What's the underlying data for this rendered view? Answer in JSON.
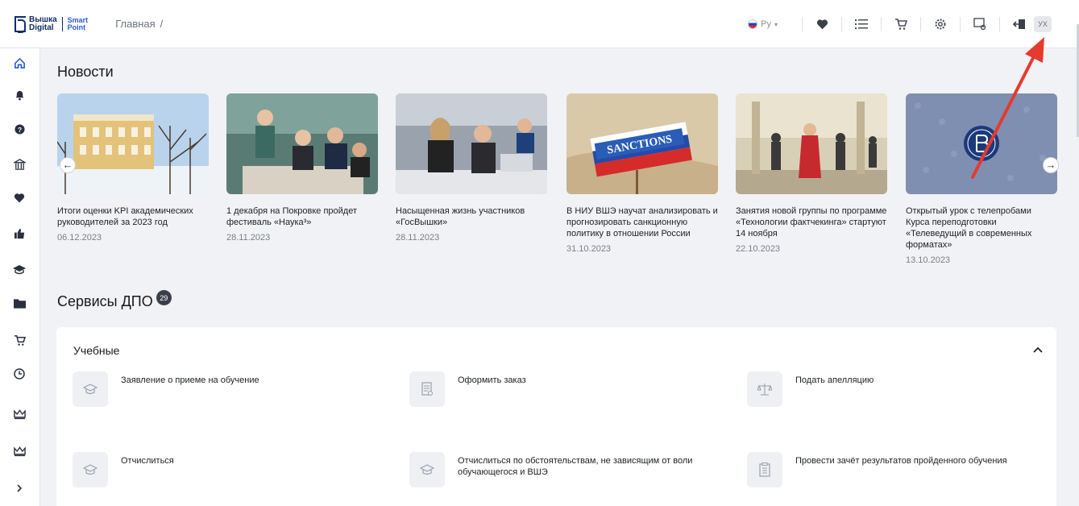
{
  "logo": {
    "line1": "Вышка",
    "line2": "Digital",
    "smart1": "Smart",
    "smart2": "Point"
  },
  "breadcrumb": {
    "home": "Главная",
    "separator": "/"
  },
  "header": {
    "lang": "Ру",
    "user_initials": "УХ"
  },
  "news": {
    "title": "Новости",
    "items": [
      {
        "caption": "Итоги оценки KPI академических руководителей за 2023 год",
        "date": "06.12.2023"
      },
      {
        "caption": "1 декабря на Покровке пройдет фестиваль «Наука³»",
        "date": "28.11.2023"
      },
      {
        "caption": "Насыщенная жизнь участников «ГосВышки»",
        "date": "28.11.2023"
      },
      {
        "caption": "В НИУ ВШЭ научат анализировать и прогнозировать санкционную политику в отношении России",
        "date": "31.10.2023"
      },
      {
        "caption": "Занятия новой группы по программе «Технологии фактчекинга» стартуют 14 ноября",
        "date": "22.10.2023"
      },
      {
        "caption": "Открытый урок с телепробами Курса переподготовки «Телеведущий в современных форматах»",
        "date": "13.10.2023"
      }
    ],
    "sanctions_sign": "SANCTIONS"
  },
  "services": {
    "title": "Сервисы ДПО",
    "count": "29",
    "panel_title": "Учебные",
    "items": [
      {
        "label": "Заявление о приеме на обучение"
      },
      {
        "label": "Оформить заказ"
      },
      {
        "label": "Подать апелляцию"
      },
      {
        "label": "Отчислиться"
      },
      {
        "label": "Отчислиться по обстоятельствам, не зависящим от воли обучающегося и ВШЭ"
      },
      {
        "label": "Провести зачёт результатов пройденного обучения"
      }
    ]
  },
  "colors": {
    "accent": "#1a4fd6",
    "annotation_arrow": "#e53a2f",
    "background": "#f1f2f5"
  }
}
